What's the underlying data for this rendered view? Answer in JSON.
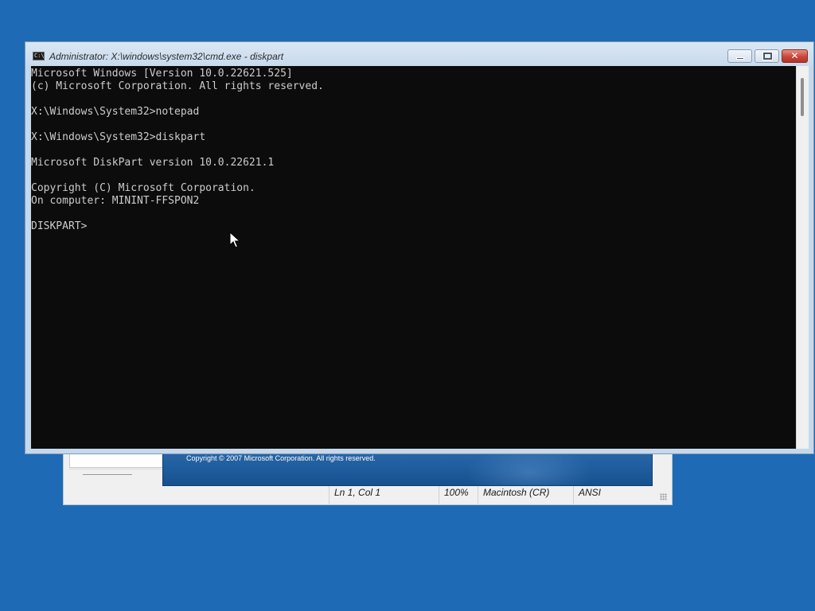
{
  "desktop": {
    "background_color": "#1f6ab5"
  },
  "notepad": {
    "about_copyright": "Copyright © 2007 Microsoft Corporation. All rights reserved.",
    "status": {
      "position": "Ln 1, Col 1",
      "zoom": "100%",
      "line_ending": "Macintosh (CR)",
      "encoding": "ANSI"
    }
  },
  "console": {
    "title": "Administrator: X:\\windows\\system32\\cmd.exe - diskpart",
    "icon": "cmd-icon",
    "lines": [
      "Microsoft Windows [Version 10.0.22621.525]",
      "(c) Microsoft Corporation. All rights reserved.",
      "",
      "X:\\Windows\\System32>notepad",
      "",
      "X:\\Windows\\System32>diskpart",
      "",
      "Microsoft DiskPart version 10.0.22621.1",
      "",
      "Copyright (C) Microsoft Corporation.",
      "On computer: MININT-FFSPON2",
      "",
      "DISKPART> "
    ],
    "colors": {
      "background": "#0c0c0c",
      "foreground": "#cccccc"
    },
    "buttons": {
      "minimize": "minimize-icon",
      "maximize": "maximize-icon",
      "close": "close-icon"
    }
  }
}
